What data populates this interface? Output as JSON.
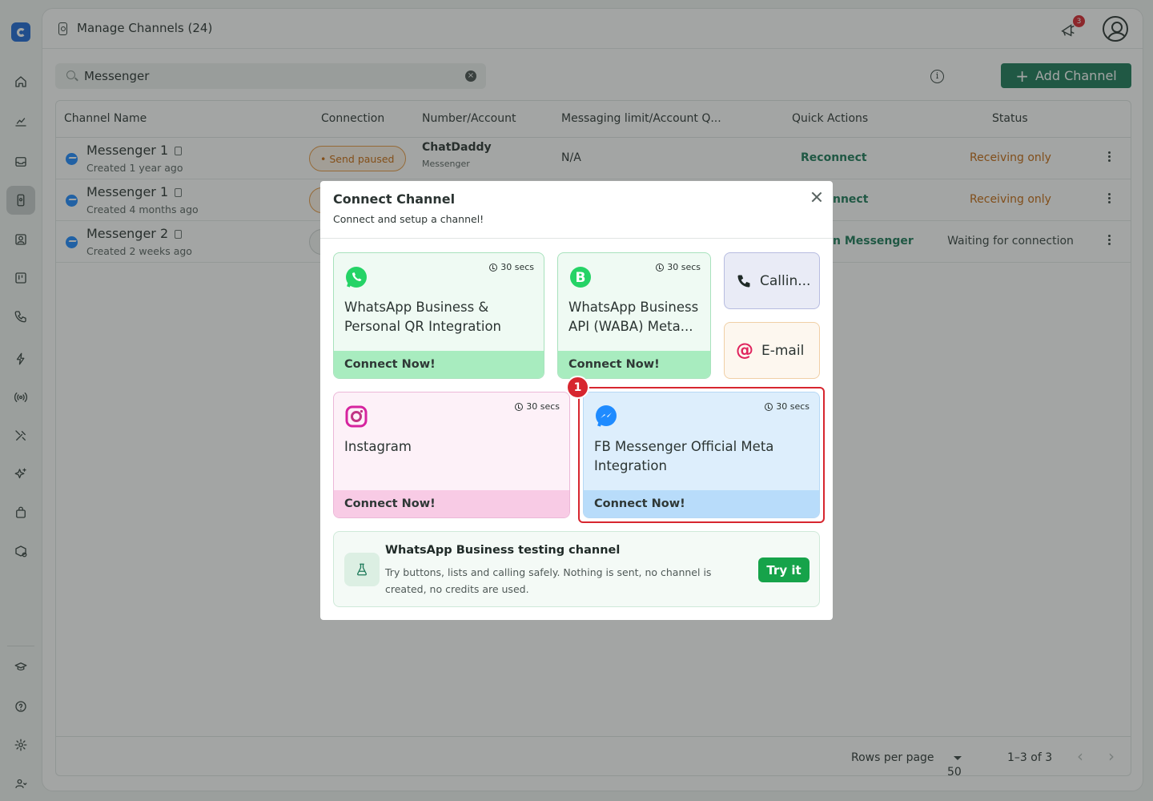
{
  "header": {
    "title": "Manage Channels  (24)",
    "notification_count": "3"
  },
  "search": {
    "value": "Messenger",
    "clear_glyph": "×"
  },
  "toolbar": {
    "info_glyph": "i",
    "add_channel_label": "Add Channel",
    "plus_glyph": "+"
  },
  "table": {
    "columns": [
      "Channel Name",
      "Connection",
      "Number/Account",
      "Messaging limit/Account Q...",
      "Quick Actions",
      "Status"
    ],
    "rows": [
      {
        "name": "Messenger 1",
        "created": "Created 1 year ago",
        "connection": "Send paused",
        "account": "ChatDaddy",
        "account_type": "Messenger",
        "limit": "N/A",
        "action": "Reconnect",
        "status": "Receiving only"
      },
      {
        "name": "Messenger 1",
        "created": "Created 4 months ago",
        "connection": "",
        "account": "",
        "account_type": "",
        "limit": "",
        "action": "nnect",
        "status": "Receiving only"
      },
      {
        "name": "Messenger 2",
        "created": "Created 2 weeks ago",
        "connection": "",
        "account": "",
        "account_type": "",
        "limit": "",
        "action": "n Messenger",
        "status": "Waiting for connection"
      }
    ],
    "footer": {
      "rows_per_page_label": "Rows per page",
      "rows_per_page_value": "50",
      "range": "1–3 of 3",
      "prev_glyph": "‹",
      "next_glyph": "›"
    }
  },
  "modal": {
    "title": "Connect Channel",
    "subtitle": "Connect and setup a channel!",
    "cards": {
      "whatsapp_qr": {
        "time": "30 secs",
        "title": "WhatsApp Business & Personal QR Integration",
        "cta": "Connect Now!"
      },
      "waba": {
        "time": "30 secs",
        "title": "WhatsApp Business API (WABA) Meta...",
        "cta": "Connect Now!"
      },
      "calling": {
        "title": "Callin..."
      },
      "email": {
        "title": "E-mail"
      },
      "instagram": {
        "time": "30 secs",
        "title": "Instagram",
        "cta": "Connect Now!"
      },
      "fb_messenger": {
        "time": "30 secs",
        "title": "FB Messenger Official Meta Integration",
        "cta": "Connect Now!"
      }
    },
    "highlight_number": "1",
    "testing": {
      "title": "WhatsApp Business testing channel",
      "description": "Try buttons, lists and calling safely. Nothing is sent, no channel is created, no credits are used.",
      "cta": "Try it"
    }
  },
  "colors": {
    "brand_green": "#1e7a5a",
    "highlight_red": "#d7262f",
    "whatsapp": "#25d366",
    "messenger": "#1f8bff"
  },
  "icons": [
    "home-icon",
    "analytics-icon",
    "inbox-icon",
    "channels-icon",
    "contacts-icon",
    "board-icon",
    "phone-icon",
    "bolt-icon",
    "broadcast-icon",
    "tools-icon",
    "sparkles-icon",
    "shop-icon",
    "package-icon",
    "academy-icon",
    "help-icon",
    "settings-icon",
    "team-icon"
  ]
}
